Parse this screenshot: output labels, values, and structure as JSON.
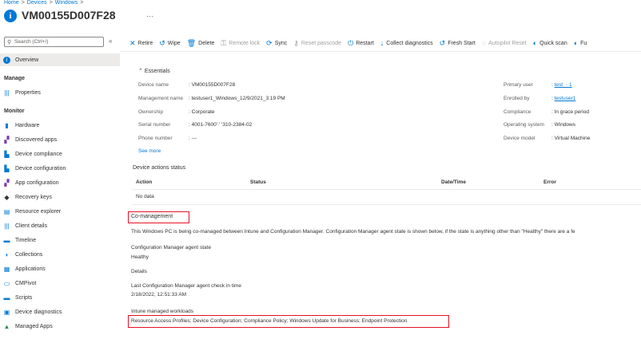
{
  "breadcrumb": [
    "Home",
    "Devices",
    "Windows"
  ],
  "page": {
    "title": "VM00155D007F28",
    "more": "···"
  },
  "sidebar": {
    "search_placeholder": "Search (Ctrl+/)",
    "collapse": "«",
    "items": [
      {
        "label": "Overview",
        "icon": "info-icon",
        "color": "#0078d4"
      },
      {
        "label": "Manage",
        "heading": true
      },
      {
        "label": "Properties",
        "icon": "properties-icon",
        "color": "#0078d4"
      },
      {
        "label": "Monitor",
        "heading": true
      },
      {
        "label": "Hardware",
        "icon": "hardware-icon",
        "color": "#0078d4"
      },
      {
        "label": "Discovered apps",
        "icon": "apps-icon",
        "color": "#7a3ab0"
      },
      {
        "label": "Device compliance",
        "icon": "compliance-icon",
        "color": "#0078d4"
      },
      {
        "label": "Device configuration",
        "icon": "configuration-icon",
        "color": "#0078d4"
      },
      {
        "label": "App configuration",
        "icon": "app-config-icon",
        "color": "#7a3ab0"
      },
      {
        "label": "Recovery keys",
        "icon": "key-icon",
        "color": "#323130"
      },
      {
        "label": "Resource explorer",
        "icon": "explorer-icon",
        "color": "#0078d4"
      },
      {
        "label": "Client details",
        "icon": "client-icon",
        "color": "#0078d4"
      },
      {
        "label": "Timeline",
        "icon": "timeline-icon",
        "color": "#0078d4"
      },
      {
        "label": "Collections",
        "icon": "collections-icon",
        "color": "#0078d4"
      },
      {
        "label": "Applications",
        "icon": "applications-icon",
        "color": "#0078d4"
      },
      {
        "label": "CMPivot",
        "icon": "cmpivot-icon",
        "color": "#0078d4"
      },
      {
        "label": "Scripts",
        "icon": "scripts-icon",
        "color": "#0078d4"
      },
      {
        "label": "Device diagnostics",
        "icon": "diagnostics-icon",
        "color": "#0078d4"
      },
      {
        "label": "Managed Apps",
        "icon": "managed-apps-icon",
        "color": "#2e8b57"
      }
    ]
  },
  "toolbar": [
    {
      "label": "Retire",
      "icon": "close-icon",
      "enabled": true
    },
    {
      "label": "Wipe",
      "icon": "wipe-icon",
      "enabled": true
    },
    {
      "label": "Delete",
      "icon": "trash-icon",
      "enabled": true
    },
    {
      "label": "Remote lock",
      "icon": "lock-icon",
      "enabled": false
    },
    {
      "label": "Sync",
      "icon": "sync-icon",
      "enabled": true
    },
    {
      "label": "Reset passcode",
      "icon": "key-icon",
      "enabled": false
    },
    {
      "label": "Restart",
      "icon": "power-icon",
      "enabled": true
    },
    {
      "label": "Collect diagnostics",
      "icon": "download-icon",
      "enabled": true
    },
    {
      "label": "Fresh Start",
      "icon": "fresh-start-icon",
      "enabled": true
    },
    {
      "label": "Autopilot Reset",
      "icon": "autopilot-icon",
      "enabled": false
    },
    {
      "label": "Quick scan",
      "icon": "scan-icon",
      "enabled": true
    },
    {
      "label": "Fu",
      "icon": "scan-icon",
      "enabled": true
    }
  ],
  "essentials": {
    "toggle": "Essentials",
    "left": [
      {
        "label": "Device name",
        "value": "VM00155D007F28"
      },
      {
        "label": "Management name",
        "value": "testuser1_Windows_12/9/2021_3:19 PM"
      },
      {
        "label": "Ownership",
        "value": "Corporate"
      },
      {
        "label": "Serial number",
        "value": "4001-7600'·'   '310-2384-02"
      },
      {
        "label": "Phone number",
        "value": "---"
      }
    ],
    "right": [
      {
        "label": "Primary user",
        "value": "test_··1",
        "link": true
      },
      {
        "label": "Enrolled by",
        "value": "testuser1",
        "link": true
      },
      {
        "label": "Compliance",
        "value": "In grace period"
      },
      {
        "label": "Operating system",
        "value": "Windows"
      },
      {
        "label": "Device model",
        "value": "Virtual Machine"
      }
    ],
    "see_more": "See more"
  },
  "device_actions": {
    "title": "Device actions status",
    "columns": [
      "Action",
      "Status",
      "Date/Time",
      "Error"
    ],
    "empty": "No data"
  },
  "comanagement": {
    "title": "Co-management",
    "description": "This Windows PC is being co-managed between Intune and Configuration Manager. Configuration Manager agent state is shown below, if the state is anything other than \"Healthy\" there are a fe",
    "agent_state_label": "Configuration Manager agent state",
    "agent_state": "Healthy",
    "details_label": "Details",
    "last_checkin_label": "Last Configuration Manager agent check in time",
    "last_checkin": "2/18/2022, 12:51:33 AM",
    "workloads_label": "Intune managed workloads",
    "workloads": "Resource Access Profiles; Device Configuration; Compliance Policy; Windows Update for Business; Endpoint Protection"
  }
}
